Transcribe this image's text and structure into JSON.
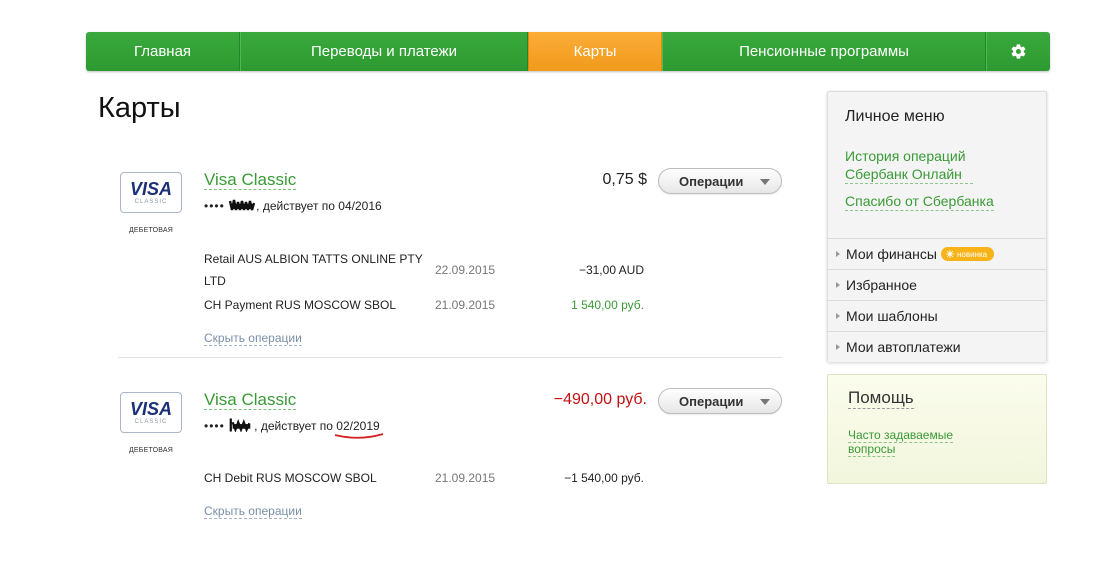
{
  "nav": {
    "items": [
      {
        "label": "Главная",
        "width": 154
      },
      {
        "label": "Переводы и платежи",
        "width": 288
      },
      {
        "label": "Карты",
        "width": 134,
        "active": true
      },
      {
        "label": "Пенсионные программы",
        "width": 324
      }
    ],
    "settings_icon": "gear-icon"
  },
  "page": {
    "title": "Карты"
  },
  "cards": [
    {
      "logo_text": "VISA",
      "logo_sub": "CLASSIC",
      "type_label": "ДЕБЕТОВАЯ",
      "name": "Visa Classic",
      "masked": "••••",
      "valid_prefix": ", действует по ",
      "expiry": "04/2016",
      "balance": "0,75 $",
      "ops_button": "Операции",
      "transactions": [
        {
          "desc": "Retail AUS ALBION TATTS ONLINE PTY LTD",
          "date": "22.09.2015",
          "amount": "−31,00 AUD",
          "positive": false
        },
        {
          "desc": "CH Payment RUS MOSCOW SBOL",
          "date": "21.09.2015",
          "amount": "1 540,00 руб.",
          "positive": true
        }
      ],
      "hide_ops": "Скрыть операции"
    },
    {
      "logo_text": "VISA",
      "logo_sub": "CLASSIC",
      "type_label": "ДЕБЕТОВАЯ",
      "name": "Visa Classic",
      "masked": "••••",
      "valid_prefix": ", действует по ",
      "expiry": "02/2019",
      "balance": "−490,00 руб.",
      "ops_button": "Операции",
      "transactions": [
        {
          "desc": "CH Debit RUS MOSCOW SBOL",
          "date": "21.09.2015",
          "amount": "−1 540,00 руб.",
          "positive": false
        }
      ],
      "hide_ops": "Скрыть операции"
    }
  ],
  "sidebar": {
    "title": "Личное меню",
    "links": [
      "История операций Сбербанк Онлайн",
      "Спасибо от Сбербанка"
    ],
    "menu": [
      {
        "label": "Мои финансы",
        "badge": "новинка"
      },
      {
        "label": "Избранное"
      },
      {
        "label": "Мои шаблоны"
      },
      {
        "label": "Мои автоплатежи"
      }
    ]
  },
  "help": {
    "title": "Помощь",
    "link": "Часто задаваемые вопросы"
  },
  "colors": {
    "brand_green": "#3aa93d",
    "active_orange": "#f7a52a",
    "negative_red": "#c31010",
    "positive_green": "#3a9a36"
  }
}
